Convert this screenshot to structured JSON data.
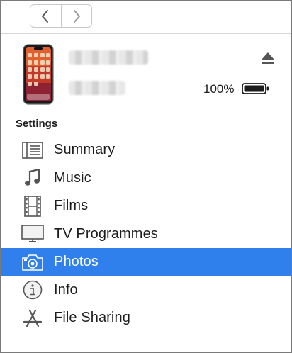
{
  "nav": {
    "back_icon": "chevron-left-icon",
    "forward_icon": "chevron-right-icon"
  },
  "device": {
    "battery_percent": "100%",
    "battery_level": 1.0,
    "eject_icon": "eject-icon"
  },
  "settings": {
    "heading": "Settings",
    "items": [
      {
        "label": "Summary",
        "icon": "summary-icon"
      },
      {
        "label": "Music",
        "icon": "music-note-icon"
      },
      {
        "label": "Films",
        "icon": "film-strip-icon"
      },
      {
        "label": "TV Programmes",
        "icon": "tv-icon"
      },
      {
        "label": "Photos",
        "icon": "camera-icon",
        "selected": true
      },
      {
        "label": "Info",
        "icon": "info-icon"
      },
      {
        "label": "File Sharing",
        "icon": "app-store-icon"
      }
    ]
  },
  "colors": {
    "selection": "#2f80ed",
    "icon_gray": "#5a5a5a"
  }
}
